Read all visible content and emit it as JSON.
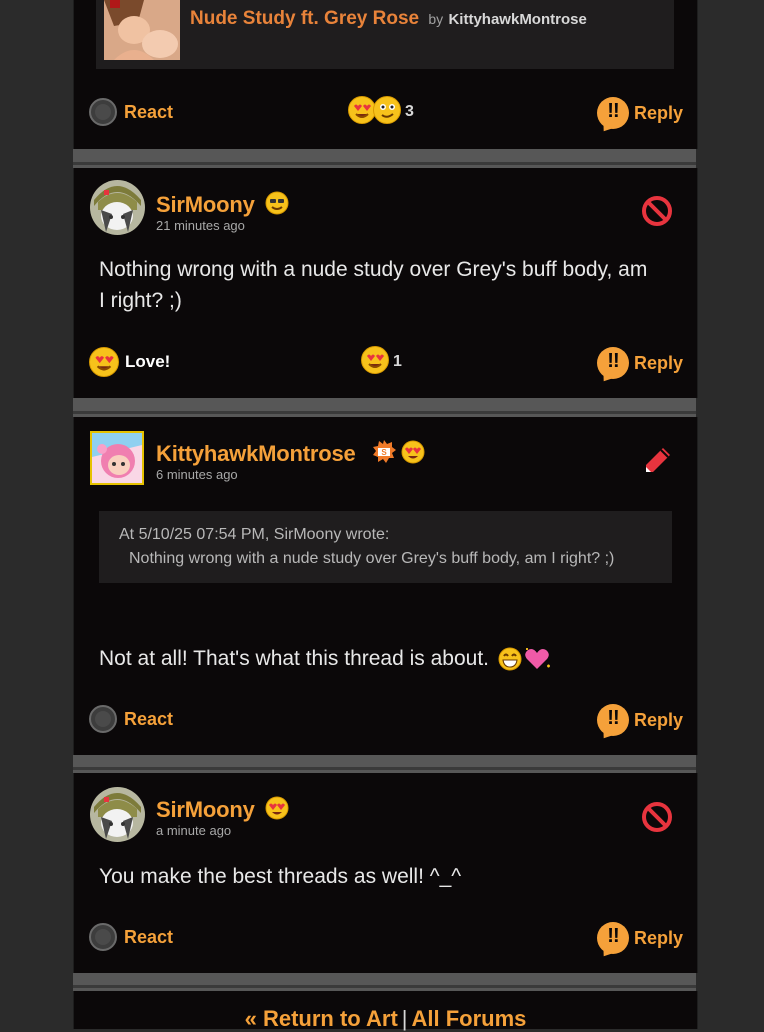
{
  "preview": {
    "title": "Nude Study ft. Grey Rose",
    "by": "by",
    "author": "KittyhawkMontrose"
  },
  "posts": [
    {
      "footer": {
        "react_label": "React",
        "reaction_count": "3",
        "reply_label": "Reply"
      }
    },
    {
      "username": "SirMoony",
      "time": "21 minutes ago",
      "body": "Nothing wrong with a nude study over Grey's buff body, am I right? ;)",
      "action_icon": "block-icon",
      "footer": {
        "love_label": "Love!",
        "reaction_count": "1",
        "reply_label": "Reply"
      }
    },
    {
      "username": "KittyhawkMontrose",
      "time": "6 minutes ago",
      "quote_header": "At 5/10/25 07:54 PM, SirMoony wrote:",
      "quote_body": "Nothing wrong with a nude study over Grey's buff body, am I right? ;)",
      "body": "Not at all! That's what this thread is about.",
      "action_icon": "edit-icon",
      "footer": {
        "react_label": "React",
        "reply_label": "Reply"
      }
    },
    {
      "username": "SirMoony",
      "time": "a minute ago",
      "body": "You make the best threads as well! ^_^",
      "action_icon": "block-icon",
      "footer": {
        "react_label": "React",
        "reply_label": "Reply"
      }
    }
  ],
  "footer_links": {
    "return_label": "« Return to Art",
    "separator": "|",
    "all_forums_label": "All Forums"
  },
  "colors": {
    "accent": "#f5a13a",
    "post_bg": "#0b0809",
    "page_bg": "#2b2b2b",
    "block_red": "#e8343e"
  }
}
